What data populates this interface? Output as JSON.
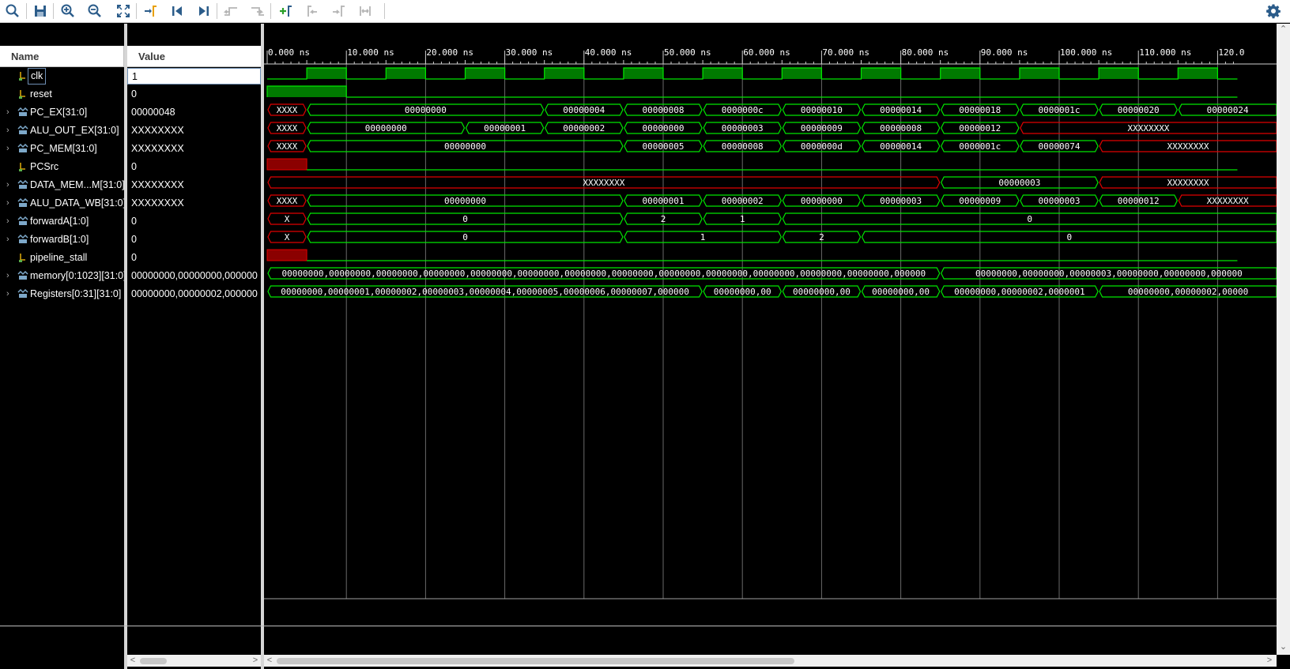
{
  "toolbar": {
    "buttons": [
      "search-icon",
      "save-icon",
      "zoom-in-icon",
      "zoom-out-icon",
      "zoom-fit-icon",
      "go-to-cursor-icon",
      "go-to-time-zero-icon",
      "go-to-last-time-icon",
      "previous-transition-icon",
      "next-transition-icon",
      "add-marker-icon",
      "previous-marker-icon",
      "next-marker-icon",
      "swap-cursors-icon"
    ],
    "settings_icon": "gear-icon"
  },
  "headers": {
    "name": "Name",
    "value": "Value"
  },
  "colors": {
    "wave_green": "#00e600",
    "wave_red": "#e00000",
    "clk_fill": "#007a00",
    "grid": "#3b3b3b"
  },
  "signals": [
    {
      "name": "clk",
      "value": "1",
      "type": "bit",
      "expandable": false,
      "selected": true
    },
    {
      "name": "reset",
      "value": "0",
      "type": "bit",
      "expandable": false
    },
    {
      "name": "PC_EX[31:0]",
      "value": "00000048",
      "type": "bus",
      "expandable": true
    },
    {
      "name": "ALU_OUT_EX[31:0]",
      "value": "XXXXXXXX",
      "type": "bus",
      "expandable": true
    },
    {
      "name": "PC_MEM[31:0]",
      "value": "XXXXXXXX",
      "type": "bus",
      "expandable": true
    },
    {
      "name": "PCSrc",
      "value": "0",
      "type": "bit",
      "expandable": false
    },
    {
      "name": "DATA_MEM...M[31:0]",
      "value": "XXXXXXXX",
      "type": "bus",
      "expandable": true
    },
    {
      "name": "ALU_DATA_WB[31:0]",
      "value": "XXXXXXXX",
      "type": "bus",
      "expandable": true
    },
    {
      "name": "forwardA[1:0]",
      "value": "0",
      "type": "bus",
      "expandable": true
    },
    {
      "name": "forwardB[1:0]",
      "value": "0",
      "type": "bus",
      "expandable": true
    },
    {
      "name": "pipeline_stall",
      "value": "0",
      "type": "bit",
      "expandable": false
    },
    {
      "name": "memory[0:1023][31:0]",
      "value": "00000000,00000000,000000",
      "type": "bus",
      "expandable": true
    },
    {
      "name": "Registers[0:31][31:0]",
      "value": "00000000,00000002,000000",
      "type": "bus",
      "expandable": true
    }
  ],
  "timeline": {
    "unit": "ns",
    "end_time": 122.5,
    "major_tick_labels": [
      "0.000 ns",
      "10.000 ns",
      "20.000 ns",
      "30.000 ns",
      "40.000 ns",
      "50.000 ns",
      "60.000 ns",
      "70.000 ns",
      "80.000 ns",
      "90.000 ns",
      "100.000 ns",
      "110.000 ns",
      "120.0"
    ]
  },
  "waves": {
    "clk": {
      "high_intervals": [
        [
          5,
          10
        ],
        [
          15,
          20
        ],
        [
          25,
          30
        ],
        [
          35,
          40
        ],
        [
          45,
          50
        ],
        [
          55,
          60
        ],
        [
          65,
          70
        ],
        [
          75,
          80
        ],
        [
          85,
          90
        ],
        [
          95,
          100
        ],
        [
          105,
          110
        ],
        [
          115,
          120
        ]
      ]
    },
    "reset": [
      {
        "t0": 0,
        "t1": 10,
        "v": "1",
        "state": "high"
      },
      {
        "t0": 10,
        "t1": 122.5,
        "v": "0",
        "state": "low"
      }
    ],
    "PC_EX[31:0]": [
      {
        "t0": 0,
        "t1": 5,
        "v": "XXXX",
        "x": true
      },
      {
        "t0": 5,
        "t1": 35,
        "v": "00000000"
      },
      {
        "t0": 35,
        "t1": 45,
        "v": "00000004"
      },
      {
        "t0": 45,
        "t1": 55,
        "v": "00000008"
      },
      {
        "t0": 55,
        "t1": 65,
        "v": "0000000c"
      },
      {
        "t0": 65,
        "t1": 75,
        "v": "00000010"
      },
      {
        "t0": 75,
        "t1": 85,
        "v": "00000014"
      },
      {
        "t0": 85,
        "t1": 95,
        "v": "00000018"
      },
      {
        "t0": 95,
        "t1": 105,
        "v": "0000001c"
      },
      {
        "t0": 105,
        "t1": 115,
        "v": "00000020"
      },
      {
        "t0": 115,
        "t1": 122.5,
        "v": "00000024"
      }
    ],
    "ALU_OUT_EX[31:0]": [
      {
        "t0": 0,
        "t1": 5,
        "v": "XXXX",
        "x": true
      },
      {
        "t0": 5,
        "t1": 25,
        "v": "00000000"
      },
      {
        "t0": 25,
        "t1": 35,
        "v": "00000001"
      },
      {
        "t0": 35,
        "t1": 45,
        "v": "00000002"
      },
      {
        "t0": 45,
        "t1": 55,
        "v": "00000000"
      },
      {
        "t0": 55,
        "t1": 65,
        "v": "00000003"
      },
      {
        "t0": 65,
        "t1": 75,
        "v": "00000009"
      },
      {
        "t0": 75,
        "t1": 85,
        "v": "00000008"
      },
      {
        "t0": 85,
        "t1": 95,
        "v": "00000012"
      },
      {
        "t0": 95,
        "t1": 122.5,
        "v": "XXXXXXXX",
        "x": true
      }
    ],
    "PC_MEM[31:0]": [
      {
        "t0": 0,
        "t1": 5,
        "v": "XXXX",
        "x": true
      },
      {
        "t0": 5,
        "t1": 45,
        "v": "00000000"
      },
      {
        "t0": 45,
        "t1": 55,
        "v": "00000005"
      },
      {
        "t0": 55,
        "t1": 65,
        "v": "00000008"
      },
      {
        "t0": 65,
        "t1": 75,
        "v": "0000000d"
      },
      {
        "t0": 75,
        "t1": 85,
        "v": "00000014"
      },
      {
        "t0": 85,
        "t1": 95,
        "v": "0000001c"
      },
      {
        "t0": 95,
        "t1": 105,
        "v": "00000074"
      },
      {
        "t0": 105,
        "t1": 122.5,
        "v": "XXXXXXXX",
        "x": true
      }
    ],
    "PCSrc": [
      {
        "t0": 0,
        "t1": 5,
        "v": "X",
        "state": "x"
      },
      {
        "t0": 5,
        "t1": 122.5,
        "v": "0",
        "state": "low"
      }
    ],
    "DATA_MEM...M[31:0]": [
      {
        "t0": 0,
        "t1": 85,
        "v": "XXXXXXXX",
        "x": true
      },
      {
        "t0": 85,
        "t1": 105,
        "v": "00000003"
      },
      {
        "t0": 105,
        "t1": 122.5,
        "v": "XXXXXXXX",
        "x": true
      }
    ],
    "ALU_DATA_WB[31:0]": [
      {
        "t0": 0,
        "t1": 5,
        "v": "XXXX",
        "x": true
      },
      {
        "t0": 5,
        "t1": 45,
        "v": "00000000"
      },
      {
        "t0": 45,
        "t1": 55,
        "v": "00000001"
      },
      {
        "t0": 55,
        "t1": 65,
        "v": "00000002"
      },
      {
        "t0": 65,
        "t1": 75,
        "v": "00000000"
      },
      {
        "t0": 75,
        "t1": 85,
        "v": "00000003"
      },
      {
        "t0": 85,
        "t1": 95,
        "v": "00000009"
      },
      {
        "t0": 95,
        "t1": 105,
        "v": "00000003"
      },
      {
        "t0": 105,
        "t1": 115,
        "v": "00000012"
      },
      {
        "t0": 115,
        "t1": 122.5,
        "v": "XXXXXXXX",
        "x": true
      }
    ],
    "forwardA[1:0]": [
      {
        "t0": 0,
        "t1": 5,
        "v": "X",
        "x": true
      },
      {
        "t0": 5,
        "t1": 45,
        "v": "0"
      },
      {
        "t0": 45,
        "t1": 55,
        "v": "2"
      },
      {
        "t0": 55,
        "t1": 65,
        "v": "1"
      },
      {
        "t0": 65,
        "t1": 122.5,
        "v": "0"
      }
    ],
    "forwardB[1:0]": [
      {
        "t0": 0,
        "t1": 5,
        "v": "X",
        "x": true
      },
      {
        "t0": 5,
        "t1": 45,
        "v": "0"
      },
      {
        "t0": 45,
        "t1": 65,
        "v": "1"
      },
      {
        "t0": 65,
        "t1": 75,
        "v": "2"
      },
      {
        "t0": 75,
        "t1": 122.5,
        "v": "0"
      }
    ],
    "pipeline_stall": [
      {
        "t0": 0,
        "t1": 5,
        "v": "X",
        "state": "x"
      },
      {
        "t0": 5,
        "t1": 122.5,
        "v": "0",
        "state": "low"
      }
    ],
    "memory[0:1023][31:0]": [
      {
        "t0": 0,
        "t1": 85,
        "v": "00000000,00000000,00000000,00000000,00000000,00000000,00000000,00000000,00000000,00000000,00000000,00000000,00000000,000000"
      },
      {
        "t0": 85,
        "t1": 122.5,
        "v": "00000000,00000000,00000003,00000000,00000000,000000"
      }
    ],
    "Registers[0:31][31:0]": [
      {
        "t0": 0,
        "t1": 55,
        "v": "00000000,00000001,00000002,00000003,00000004,00000005,00000006,00000007,000000"
      },
      {
        "t0": 55,
        "t1": 65,
        "v": "00000000,00"
      },
      {
        "t0": 65,
        "t1": 75,
        "v": "00000000,00"
      },
      {
        "t0": 75,
        "t1": 85,
        "v": "00000000,00"
      },
      {
        "t0": 85,
        "t1": 105,
        "v": "00000000,00000002,0000001"
      },
      {
        "t0": 105,
        "t1": 122.5,
        "v": "00000000,00000002,00000"
      }
    ]
  }
}
